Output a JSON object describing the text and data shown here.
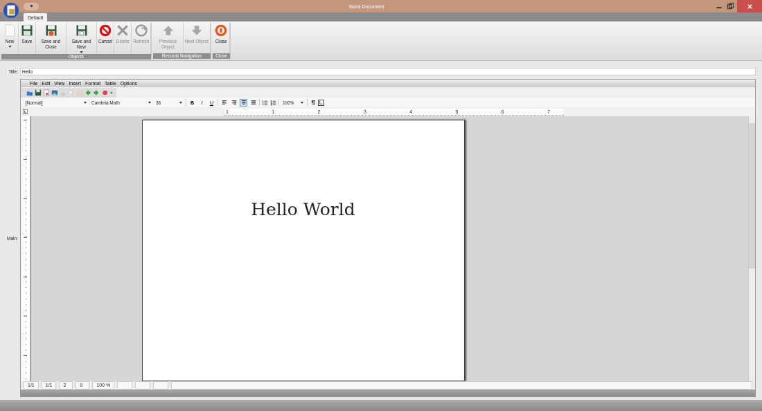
{
  "window": {
    "title": "Word Document"
  },
  "tabs": [
    {
      "label": "Default",
      "selected": true
    }
  ],
  "ribbon_groups": [
    {
      "label": "Objects",
      "buttons": [
        {
          "label": "New",
          "kind": "page",
          "disabled": false,
          "dropdown": true
        },
        {
          "label": "Save",
          "kind": "disk",
          "disabled": false,
          "dropdown": false
        },
        {
          "label": "Save and Close",
          "kind": "disk-close",
          "disabled": false,
          "dropdown": false
        },
        {
          "label": "Save and New",
          "kind": "disk-new",
          "disabled": false,
          "dropdown": true
        },
        {
          "label": "Cancel",
          "kind": "cancel",
          "disabled": false,
          "dropdown": false
        },
        {
          "label": "Delete",
          "kind": "delete",
          "disabled": true,
          "dropdown": false
        },
        {
          "label": "Refresh",
          "kind": "refresh",
          "disabled": true,
          "dropdown": false
        }
      ]
    },
    {
      "label": "Records Navigation",
      "buttons": [
        {
          "label": "Previous Object",
          "kind": "up",
          "disabled": true,
          "dropdown": false
        },
        {
          "label": "Next Object",
          "kind": "down",
          "disabled": true,
          "dropdown": false
        }
      ]
    },
    {
      "label": "Close",
      "buttons": [
        {
          "label": "Close",
          "kind": "close",
          "disabled": false,
          "dropdown": false
        }
      ]
    }
  ],
  "title_field": {
    "label": "Title:",
    "value": "Hello"
  },
  "main_label": "Main:",
  "editor": {
    "menu": [
      "File",
      "Edit",
      "View",
      "Insert",
      "Format",
      "Table",
      "Options"
    ],
    "style": "[Normal]",
    "font": "Cambria Math",
    "size": "36",
    "zoom": "100%",
    "formatting": [
      {
        "kind": "bold",
        "label": "B",
        "selected": false
      },
      {
        "kind": "italic",
        "label": "I",
        "selected": false
      },
      {
        "kind": "underline",
        "label": "U",
        "selected": false
      }
    ],
    "alignment": [
      {
        "kind": "left",
        "selected": false
      },
      {
        "kind": "right",
        "selected": false
      },
      {
        "kind": "center",
        "selected": true
      },
      {
        "kind": "justify",
        "selected": false
      }
    ],
    "ruler_marks": [
      "1",
      "1",
      "2",
      "3",
      "4",
      "5",
      "6",
      "7"
    ],
    "text": "Hello World",
    "status": [
      "1/1",
      "1/1",
      "2",
      "0",
      "100 %"
    ]
  }
}
